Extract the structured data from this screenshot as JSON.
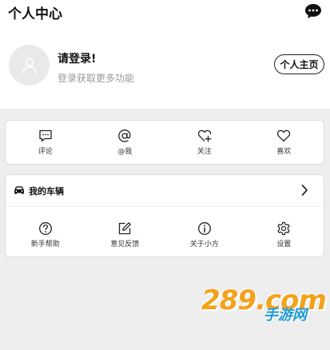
{
  "header": {
    "title": "个人中心",
    "message_icon": "chat-bubble-icon"
  },
  "profile": {
    "avatar_icon": "user-avatar-icon",
    "login_title": "请登录!",
    "login_subtitle": "登录获取更多功能",
    "homepage_button": "个人主页"
  },
  "actions": [
    {
      "label": "评论",
      "icon": "comment-icon"
    },
    {
      "label": "@我",
      "icon": "at-icon"
    },
    {
      "label": "关注",
      "icon": "heart-plus-icon"
    },
    {
      "label": "喜欢",
      "icon": "heart-icon"
    }
  ],
  "vehicle": {
    "label": "我的车辆",
    "icon": "car-icon"
  },
  "tools": [
    {
      "label": "新手帮助",
      "icon": "help-icon"
    },
    {
      "label": "意见反馈",
      "icon": "feedback-icon"
    },
    {
      "label": "关于小方",
      "icon": "info-icon"
    },
    {
      "label": "设置",
      "icon": "gear-icon"
    }
  ],
  "watermark": {
    "main": "289.com",
    "sub": "手游网"
  },
  "colors": {
    "background": "#eeeeee",
    "watermark_orange": "#f3a21d",
    "watermark_blue": "#1f9ad6"
  }
}
